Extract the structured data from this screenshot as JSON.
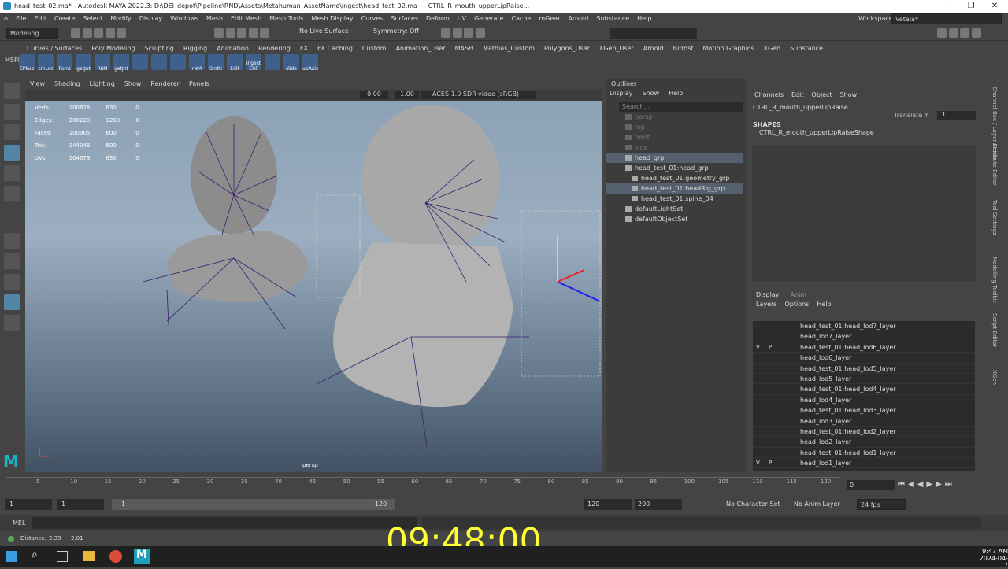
{
  "title_bar": {
    "text": "head_test_02.ma* - Autodesk MAYA 2022.3: D:\\DEI_depot\\Pipeline\\RND\\Assets\\Metahuman_AssetName\\ingest\\head_test_02.ma  ---  CTRL_R_mouth_upperLipRaise..."
  },
  "menu": [
    "File",
    "Edit",
    "Create",
    "Select",
    "Modify",
    "Display",
    "Windows",
    "Mesh",
    "Edit Mesh",
    "Mesh Tools",
    "Mesh Display",
    "Curves",
    "Surfaces",
    "Deform",
    "UV",
    "Generate",
    "Cache",
    "mGear",
    "Arnold",
    "Substance",
    "Help"
  ],
  "workspace_label": "Workspace:",
  "workspace_value": "Vetala*",
  "mode": "Modeling",
  "live_surface": "No Live Surface",
  "symmetry": "Symmetry: Off",
  "shelf_tabs": [
    "Curves / Surfaces",
    "Poly Modeling",
    "Sculpting",
    "Rigging",
    "Animation",
    "Rendering",
    "FX",
    "FX Caching",
    "Custom",
    "Animation_User",
    "MASH",
    "Mathias_Custom",
    "Polygons_User",
    "XGen_User",
    "Arnold",
    "Bifrost",
    "Motion Graphics",
    "XGen",
    "Substance",
    "MSPlugin"
  ],
  "shelf_icons": [
    "CPkup",
    "cmLoc",
    "Point",
    "getJnt",
    "RBN",
    "getJnt",
    "",
    "",
    "",
    "rNM",
    "Smth",
    "Edit",
    "ingest ERF",
    "",
    "slide",
    "upAxis"
  ],
  "viewport": {
    "menus": [
      "View",
      "Shading",
      "Lighting",
      "Show",
      "Renderer",
      "Panels"
    ],
    "exposure": "0.00",
    "gamma": "1.00",
    "color_space": "ACES 1.0 SDR-video (sRGB)",
    "hud": [
      {
        "label": "Verts:",
        "a": "100628",
        "b": "630",
        "c": "0"
      },
      {
        "label": "Edges:",
        "a": "200228",
        "b": "1200",
        "c": "0"
      },
      {
        "label": "Faces:",
        "a": "100905",
        "b": "600",
        "c": "0"
      },
      {
        "label": "Tris:",
        "a": "144048",
        "b": "600",
        "c": "0"
      },
      {
        "label": "UVs:",
        "a": "104673",
        "b": "630",
        "c": "0"
      }
    ],
    "camera": "persp"
  },
  "outliner": {
    "title": "Outliner",
    "menus": [
      "Display",
      "Show",
      "Help"
    ],
    "search": "Search...",
    "items": [
      {
        "label": "persp",
        "grey": true,
        "indent": 0,
        "sel": false
      },
      {
        "label": "top",
        "grey": true,
        "indent": 0,
        "sel": false
      },
      {
        "label": "front",
        "grey": true,
        "indent": 0,
        "sel": false
      },
      {
        "label": "side",
        "grey": true,
        "indent": 0,
        "sel": false
      },
      {
        "label": "head_grp",
        "grey": false,
        "indent": 0,
        "sel": true
      },
      {
        "label": "head_test_01:head_grp",
        "grey": false,
        "indent": 0,
        "sel": false
      },
      {
        "label": "head_test_01:geometry_grp",
        "grey": false,
        "indent": 1,
        "sel": false
      },
      {
        "label": "head_test_01:headRig_grp",
        "grey": false,
        "indent": 1,
        "sel": true
      },
      {
        "label": "head_test_01:spine_04",
        "grey": false,
        "indent": 1,
        "sel": false
      },
      {
        "label": "defaultLightSet",
        "grey": false,
        "indent": 0,
        "sel": false
      },
      {
        "label": "defaultObjectSet",
        "grey": false,
        "indent": 0,
        "sel": false
      }
    ]
  },
  "channel_box": {
    "menus": [
      "Channels",
      "Edit",
      "Object",
      "Show"
    ],
    "object": "CTRL_R_mouth_upperLipRaise . . .",
    "attr": "Translate Y",
    "attr_value": "1",
    "shapes_label": "SHAPES",
    "shape": "CTRL_R_mouth_upperLipRaiseShape",
    "tabs": [
      "Display",
      "Anim"
    ],
    "layer_menus": [
      "Layers",
      "Options",
      "Help"
    ],
    "layers": [
      {
        "v": "",
        "p": "",
        "name": "head_test_01:head_lod7_layer"
      },
      {
        "v": "",
        "p": "",
        "name": "head_lod7_layer"
      },
      {
        "v": "V",
        "p": "P",
        "name": "head_test_01:head_lod6_layer"
      },
      {
        "v": "",
        "p": "",
        "name": "head_lod6_layer"
      },
      {
        "v": "",
        "p": "",
        "name": "head_test_01:head_lod5_layer"
      },
      {
        "v": "",
        "p": "",
        "name": "head_lod5_layer"
      },
      {
        "v": "",
        "p": "",
        "name": "head_test_01:head_lod4_layer"
      },
      {
        "v": "",
        "p": "",
        "name": "head_lod4_layer"
      },
      {
        "v": "",
        "p": "",
        "name": "head_test_01:head_lod3_layer"
      },
      {
        "v": "",
        "p": "",
        "name": "head_lod3_layer"
      },
      {
        "v": "",
        "p": "",
        "name": "head_test_01:head_lod2_layer"
      },
      {
        "v": "",
        "p": "",
        "name": "head_lod2_layer"
      },
      {
        "v": "",
        "p": "",
        "name": "head_test_01:head_lod1_layer"
      },
      {
        "v": "V",
        "p": "P",
        "name": "head_lod1_layer"
      }
    ]
  },
  "right_strip": [
    "Channel Box / Layer Editor",
    "Attribute Editor",
    "Tool Settings",
    "Modelling Toolkit",
    "Script Editor",
    "XGen"
  ],
  "timeline": {
    "ticks": [
      "5",
      "10",
      "15",
      "20",
      "25",
      "30",
      "35",
      "40",
      "45",
      "50",
      "55",
      "60",
      "65",
      "70",
      "75",
      "80",
      "85",
      "90",
      "95",
      "100",
      "105",
      "110",
      "115",
      "120"
    ],
    "current_frame": "0"
  },
  "range": {
    "start": "1",
    "start_inner": "1",
    "slider_start": "1",
    "slider_end": "120",
    "end_inner": "120",
    "end": "200",
    "character_set": "No Character Set",
    "anim_layer": "No Anim Layer",
    "fps": "24 fps"
  },
  "command_line": {
    "lang": "MEL"
  },
  "help_line": {
    "label": "Distance:",
    "a": "2.39",
    "b": "2.01"
  },
  "overlay_clock": "09:48:00",
  "taskbar": {
    "time": "9:47 AM",
    "date": "2024-04-17"
  }
}
